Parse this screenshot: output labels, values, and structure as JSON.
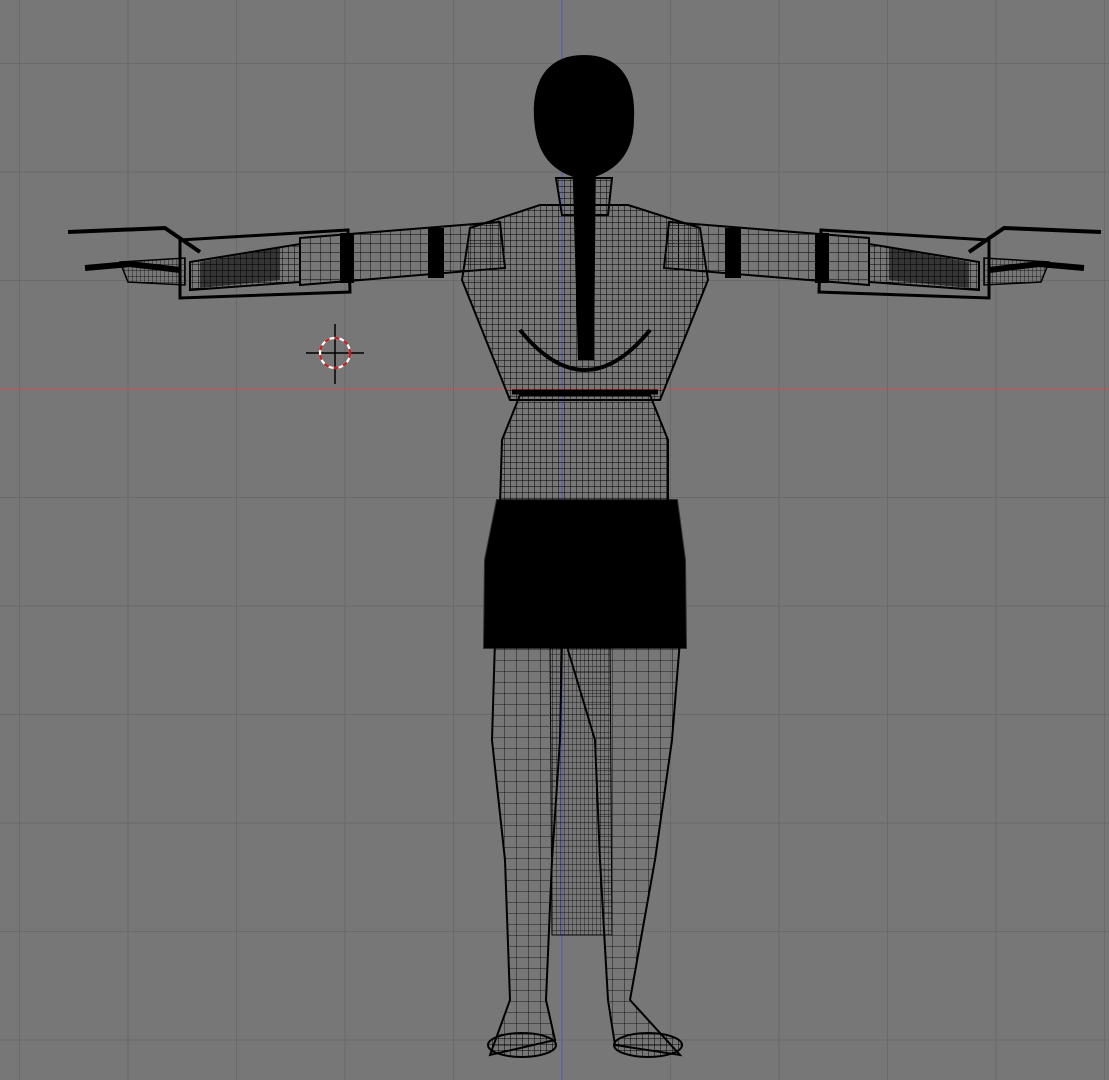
{
  "viewport": {
    "view": "front-orthographic",
    "shading": "wireframe",
    "background_color": "#777777",
    "grid_color": "#6a6a6a",
    "x_axis_color": "#b85a5a",
    "z_axis_color": "#5a62b8",
    "wire_color": "#000000"
  },
  "scene": {
    "object": "human-character-mesh",
    "pose": "t-pose",
    "cursor_icon": "3d-cursor-icon"
  }
}
